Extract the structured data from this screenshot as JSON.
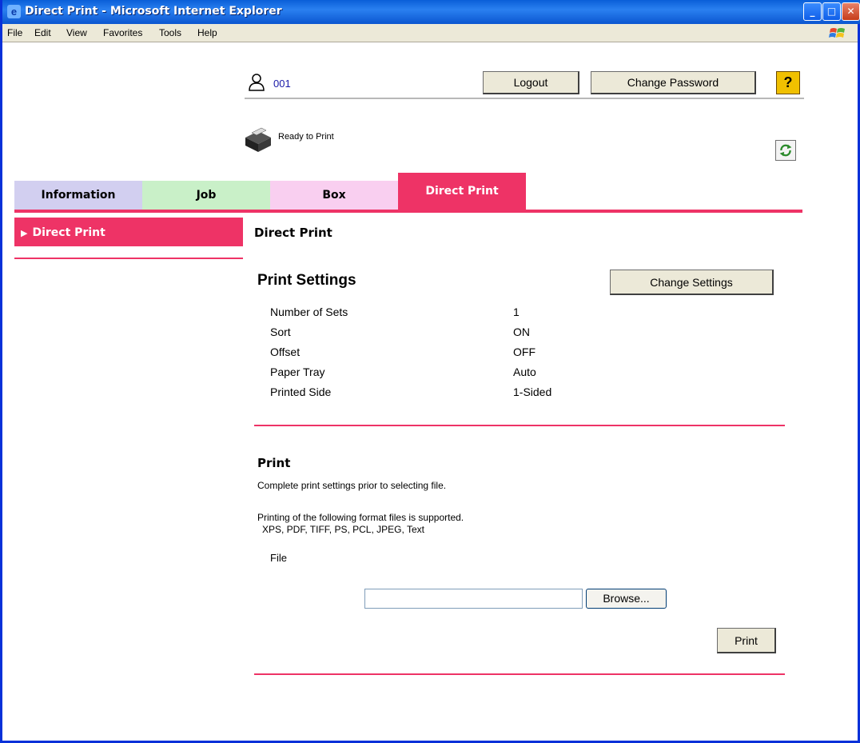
{
  "window": {
    "title": "Direct Print - Microsoft Internet Explorer",
    "controls": {
      "minimize": "_",
      "maximize": "□",
      "close": "✕"
    }
  },
  "menubar": {
    "items": [
      "File",
      "Edit",
      "View",
      "Favorites",
      "Tools",
      "Help"
    ]
  },
  "header": {
    "user_id": "001",
    "logout_label": "Logout",
    "change_password_label": "Change Password",
    "help_label": "?",
    "status_text": "Ready to Print"
  },
  "tabs": [
    {
      "label": "Information"
    },
    {
      "label": "Job"
    },
    {
      "label": "Box"
    },
    {
      "label": "Direct Print",
      "active": true
    }
  ],
  "sidebar": {
    "items": [
      {
        "label": "Direct Print",
        "active": true
      }
    ]
  },
  "main": {
    "heading": "Direct Print",
    "print_settings": {
      "title": "Print Settings",
      "change_button": "Change Settings",
      "rows": [
        {
          "label": "Number of Sets",
          "value": "1"
        },
        {
          "label": "Sort",
          "value": "ON"
        },
        {
          "label": "Offset",
          "value": "OFF"
        },
        {
          "label": "Paper Tray",
          "value": "Auto"
        },
        {
          "label": "Printed Side",
          "value": "1-Sided"
        }
      ]
    },
    "print": {
      "title": "Print",
      "note": "Complete print settings prior to selecting file.",
      "supported_intro": "Printing of the following format files is supported.",
      "formats": "XPS, PDF, TIFF, PS, PCL, JPEG, Text",
      "file_label": "File",
      "file_value": "",
      "browse_label": "Browse...",
      "print_label": "Print"
    }
  },
  "colors": {
    "accent": "#ee3366",
    "tab_information": "#d2cff0",
    "tab_job": "#c9f0c8",
    "tab_box": "#f9cff0",
    "titlebar": "#0a5fd8"
  },
  "icons": [
    "ie-icon",
    "windows-logo-icon",
    "user-icon",
    "printer-icon",
    "help-icon",
    "refresh-icon"
  ]
}
